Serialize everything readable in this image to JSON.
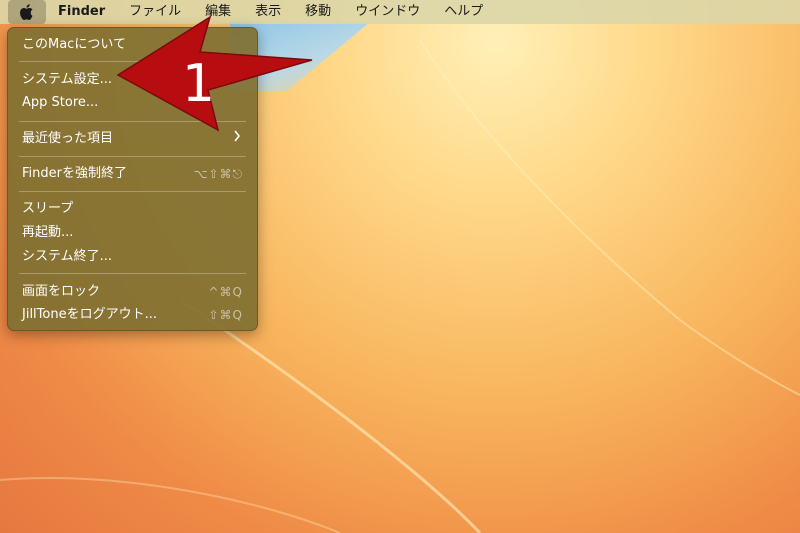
{
  "menubar": {
    "app_name": "Finder",
    "menus": [
      "ファイル",
      "編集",
      "表示",
      "移動",
      "ウインドウ",
      "ヘルプ"
    ]
  },
  "apple_menu": {
    "items": [
      {
        "label": "このMacについて"
      },
      {
        "label": "システム設定..."
      },
      {
        "label": "App Store..."
      },
      {
        "label": "最近使った項目"
      },
      {
        "label": "Finderを強制終了",
        "shortcut": "⌥⇧⌘⎋"
      },
      {
        "label": "スリープ"
      },
      {
        "label": "再起動..."
      },
      {
        "label": "システム終了..."
      },
      {
        "label": "画面をロック",
        "shortcut": "^⌘Q"
      },
      {
        "label": "JillToneをログアウト...",
        "shortcut": "⇧⌘Q"
      }
    ]
  },
  "annotation": {
    "number": "1",
    "color": "#b80d10"
  },
  "colors": {
    "menu_bg": "#807032",
    "menubar_bg": "#dcd6a8",
    "annotation_red": "#b80d10"
  }
}
